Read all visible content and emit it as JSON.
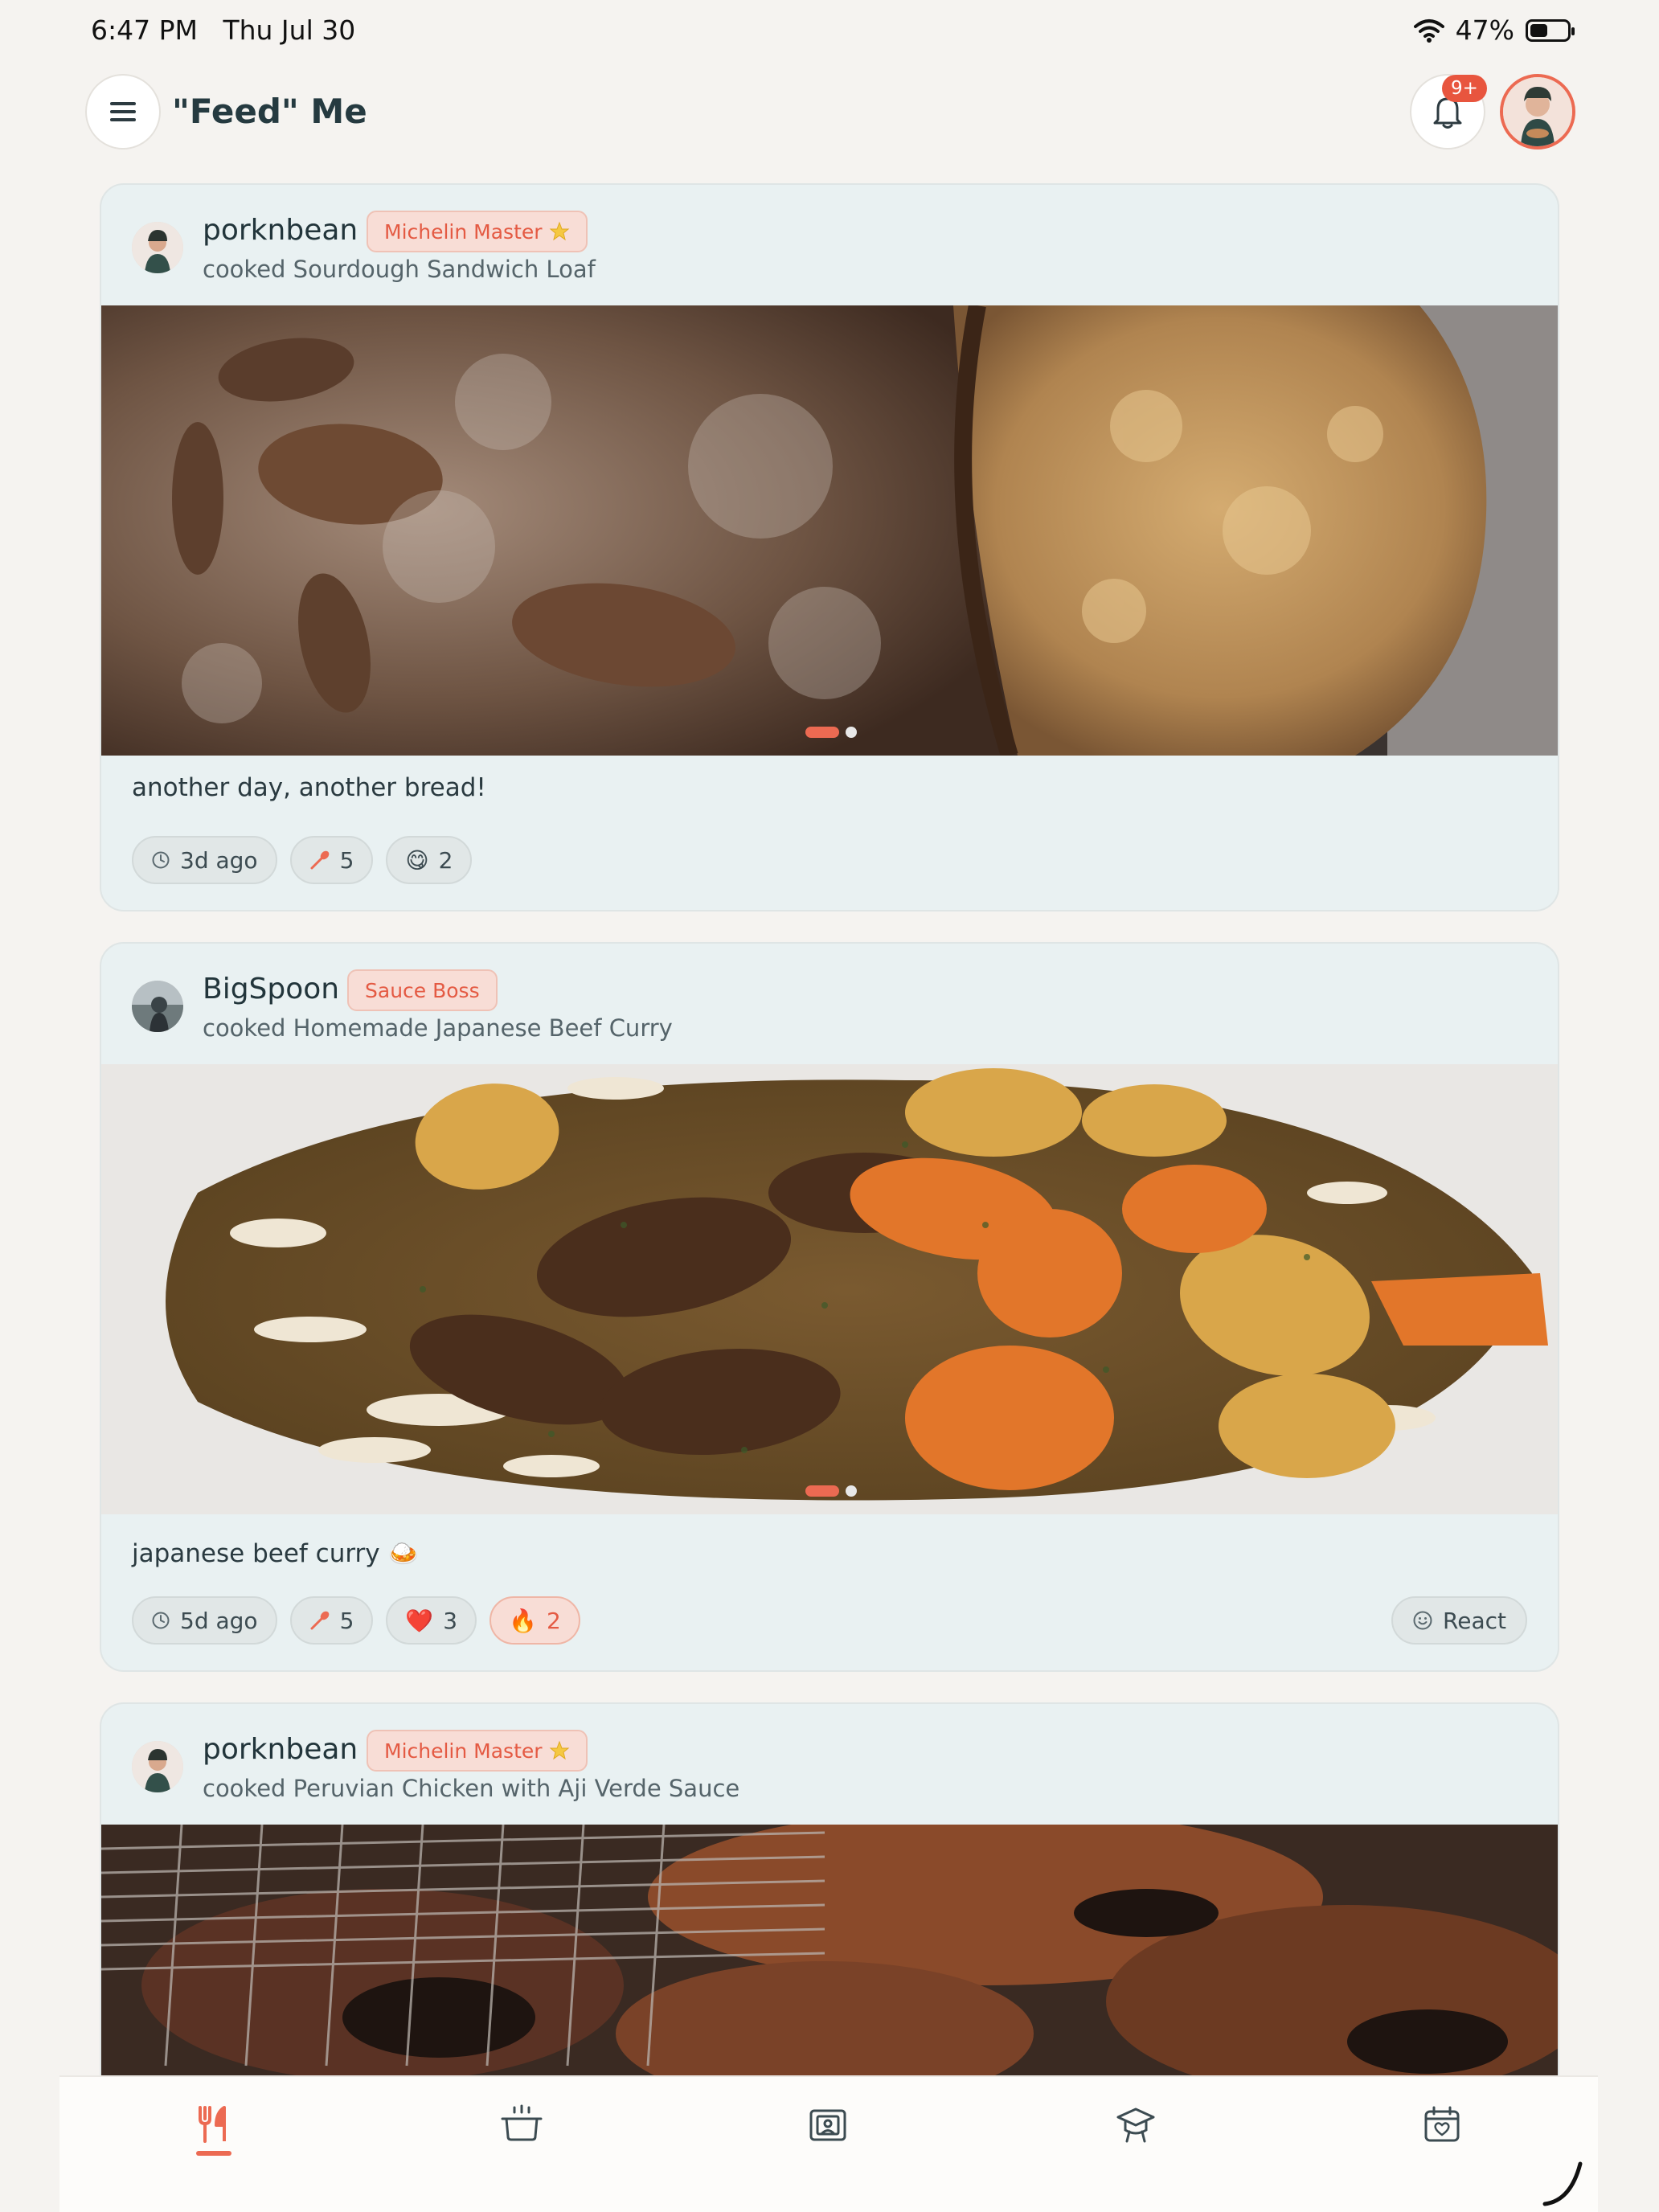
{
  "status_bar": {
    "time": "6:47 PM",
    "date": "Thu Jul 30",
    "battery_percent": "47%",
    "battery_level": 0.47
  },
  "header": {
    "menu_icon": "hamburger-menu-icon",
    "title": "\"Feed\" Me",
    "notification_icon": "bell-icon",
    "notification_count": "9+",
    "profile_icon": "profile-avatar"
  },
  "posts": [
    {
      "username": "porknbean",
      "rank": "Michelin Master",
      "rank_icon": "star-icon",
      "action": "cooked Sourdough Sandwich Loaf",
      "caption": "another day, another bread!",
      "photo_count": 2,
      "photo_index": 1,
      "stats": {
        "time_ago": "3d ago",
        "cooks": "5"
      },
      "reactions": [
        {
          "emoji": "😋",
          "count": "2",
          "highlighted": false
        }
      ],
      "show_react_button": false
    },
    {
      "username": "BigSpoon",
      "rank": "Sauce Boss",
      "action": "cooked Homemade Japanese Beef Curry",
      "caption": "japanese beef curry 🍛",
      "photo_count": 2,
      "photo_index": 1,
      "stats": {
        "time_ago": "5d ago",
        "cooks": "5"
      },
      "reactions": [
        {
          "emoji": "❤️",
          "count": "3",
          "highlighted": false
        },
        {
          "emoji": "🔥",
          "count": "2",
          "highlighted": true
        }
      ],
      "react_label": "React",
      "react_icon": "smiley-icon",
      "show_react_button": true
    },
    {
      "username": "porknbean",
      "rank": "Michelin Master",
      "rank_icon": "star-icon",
      "action": "cooked Peruvian Chicken with Aji Verde Sauce"
    }
  ],
  "tabbar": {
    "tabs": [
      {
        "icon": "fork-knife-icon",
        "active": true
      },
      {
        "icon": "cooking-pot-icon",
        "active": false
      },
      {
        "icon": "recipe-book-icon",
        "active": false
      },
      {
        "icon": "chef-hat-icon",
        "active": false
      },
      {
        "icon": "calendar-heart-icon",
        "active": false
      }
    ]
  },
  "colors": {
    "accent": "#ec6a52",
    "card_bg": "#e9f1f2",
    "page_bg": "#f5f3f0",
    "text": "#22353b"
  }
}
